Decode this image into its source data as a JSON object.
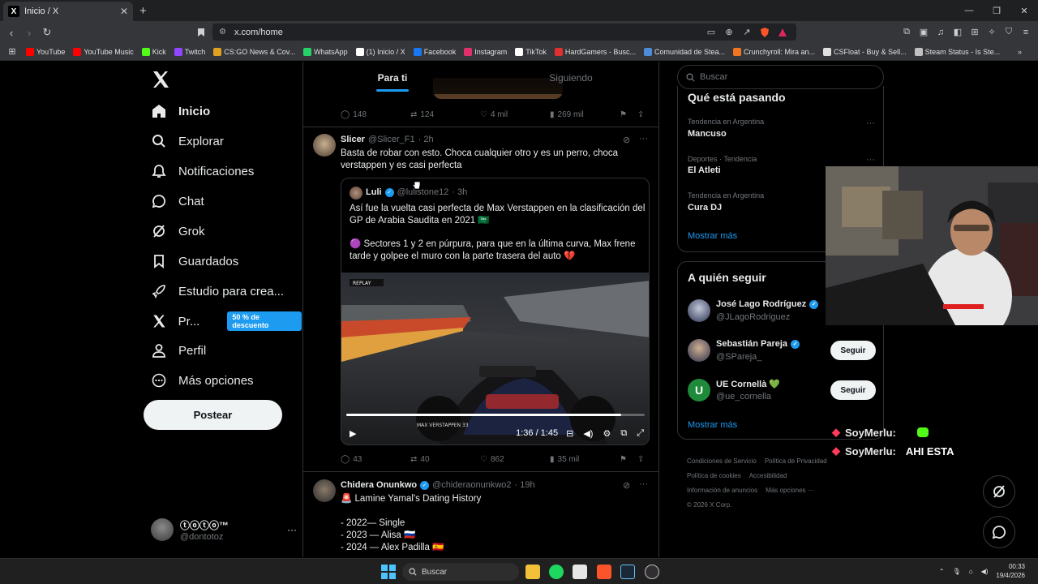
{
  "browser": {
    "tab_title": "Inicio / X",
    "url": "x.com/home",
    "bookmarks": [
      "YouTube",
      "YouTube Music",
      "Kick",
      "Twitch",
      "CS:GO News & Cov...",
      "WhatsApp",
      "(1) Inicio / X",
      "Facebook",
      "Instagram",
      "TikTok",
      "HardGamers - Busc...",
      "Comunidad de Stea...",
      "Crunchyroll: Mira an...",
      "CSFloat - Buy & Sell...",
      "Steam Status - Is Ste..."
    ],
    "bookmark_colors": [
      "#ff0000",
      "#ff0000",
      "#53fc18",
      "#9146ff",
      "#e0a020",
      "#25d366",
      "#ffffff",
      "#1877f2",
      "#e1306c",
      "#ffffff",
      "#e03030",
      "#4b8bd8",
      "#f47521",
      "#e0e0e0",
      "#c0c0c0"
    ]
  },
  "nav": {
    "items": [
      {
        "label": "Inicio",
        "icon": "home-icon"
      },
      {
        "label": "Explorar",
        "icon": "search-icon"
      },
      {
        "label": "Notificaciones",
        "icon": "bell-icon"
      },
      {
        "label": "Chat",
        "icon": "chat-icon"
      },
      {
        "label": "Grok",
        "icon": "grok-icon"
      },
      {
        "label": "Guardados",
        "icon": "bookmark-icon"
      },
      {
        "label": "Estudio para crea...",
        "icon": "rocket-icon"
      },
      {
        "label": "Pr...",
        "icon": "x-premium-icon"
      },
      {
        "label": "Perfil",
        "icon": "person-icon"
      },
      {
        "label": "Más opciones",
        "icon": "more-circle-icon"
      }
    ],
    "promo_badge": "50 % de descuento",
    "post_button": "Postear",
    "profile_name": "ⓣⓞⓣⓞ™",
    "profile_handle": "@dontotoz"
  },
  "timeline": {
    "tabs": [
      "Para ti",
      "Siguiendo"
    ],
    "prev_actions": {
      "replies": "148",
      "reposts": "124",
      "likes": "4 mil",
      "views": "269 mil"
    },
    "tweet1": {
      "name": "Slicer",
      "handle": "@Slicer_F1",
      "time": "· 2h",
      "text": "Basta de robar con esto. Choca cualquier otro y es un perro, choca verstappen y es casi perfecta",
      "quote": {
        "name": "Luli",
        "handle": "@lulistone12",
        "time": "· 3h",
        "text1": "Así fue la vuelta casi perfecta de Max Verstappen en la clasificación del GP de Arabia Saudita en 2021 🇸🇦",
        "text2": "🟣 Sectores 1 y 2 en púrpura, para que en la última curva, Max frene tarde y golpee el muro con la parte trasera del auto 💔",
        "video_time": "1:36 / 1:45",
        "replay_label": "REPLAY",
        "driver_label": "MAX VERSTAPPEN 33"
      },
      "actions": {
        "replies": "43",
        "reposts": "40",
        "likes": "862",
        "views": "35 mil"
      }
    },
    "tweet2": {
      "name": "Chidera Onunkwo",
      "handle": "@chideraonunkwo2",
      "time": "· 19h",
      "title": "🚨 Lamine Yamal's Dating History",
      "lines": [
        "- 2022— Single",
        "- 2023 — Alisa 🇷🇺",
        "- 2024 — Alex Padilla 🇪🇸"
      ]
    }
  },
  "sidebar": {
    "search_placeholder": "Buscar",
    "trends_title": "Qué está pasando",
    "trends": [
      {
        "meta": "Tendencia en Argentina",
        "name": "Mancuso"
      },
      {
        "meta": "Deportes · Tendencia",
        "name": "El Atleti"
      },
      {
        "meta": "Tendencia en Argentina",
        "name": "Cura DJ"
      }
    ],
    "show_more": "Mostrar más",
    "follow_title": "A quién seguir",
    "follow": [
      {
        "name": "José Lago Rodríguez",
        "handle": "@JLagoRodriguez",
        "button": ""
      },
      {
        "name": "Sebastián Pareja",
        "handle": "@SPareja_",
        "button": "Seguir"
      },
      {
        "name": "UE Cornellà 💚",
        "handle": "@ue_cornella",
        "button": "Seguir"
      }
    ],
    "footer": [
      "Condiciones de Servicio",
      "Política de Privacidad",
      "Política de cookies",
      "Accesibilidad",
      "Información de anuncios",
      "Más opciones ···",
      "© 2026 X Corp."
    ]
  },
  "overlay": {
    "chat": [
      {
        "user": "SoyMerlu:",
        "msg": ""
      },
      {
        "user": "SoyMerlu:",
        "msg": "AHI ESTA"
      }
    ]
  },
  "taskbar": {
    "search": "Buscar",
    "time": "00:33",
    "date": "19/4/2026"
  }
}
